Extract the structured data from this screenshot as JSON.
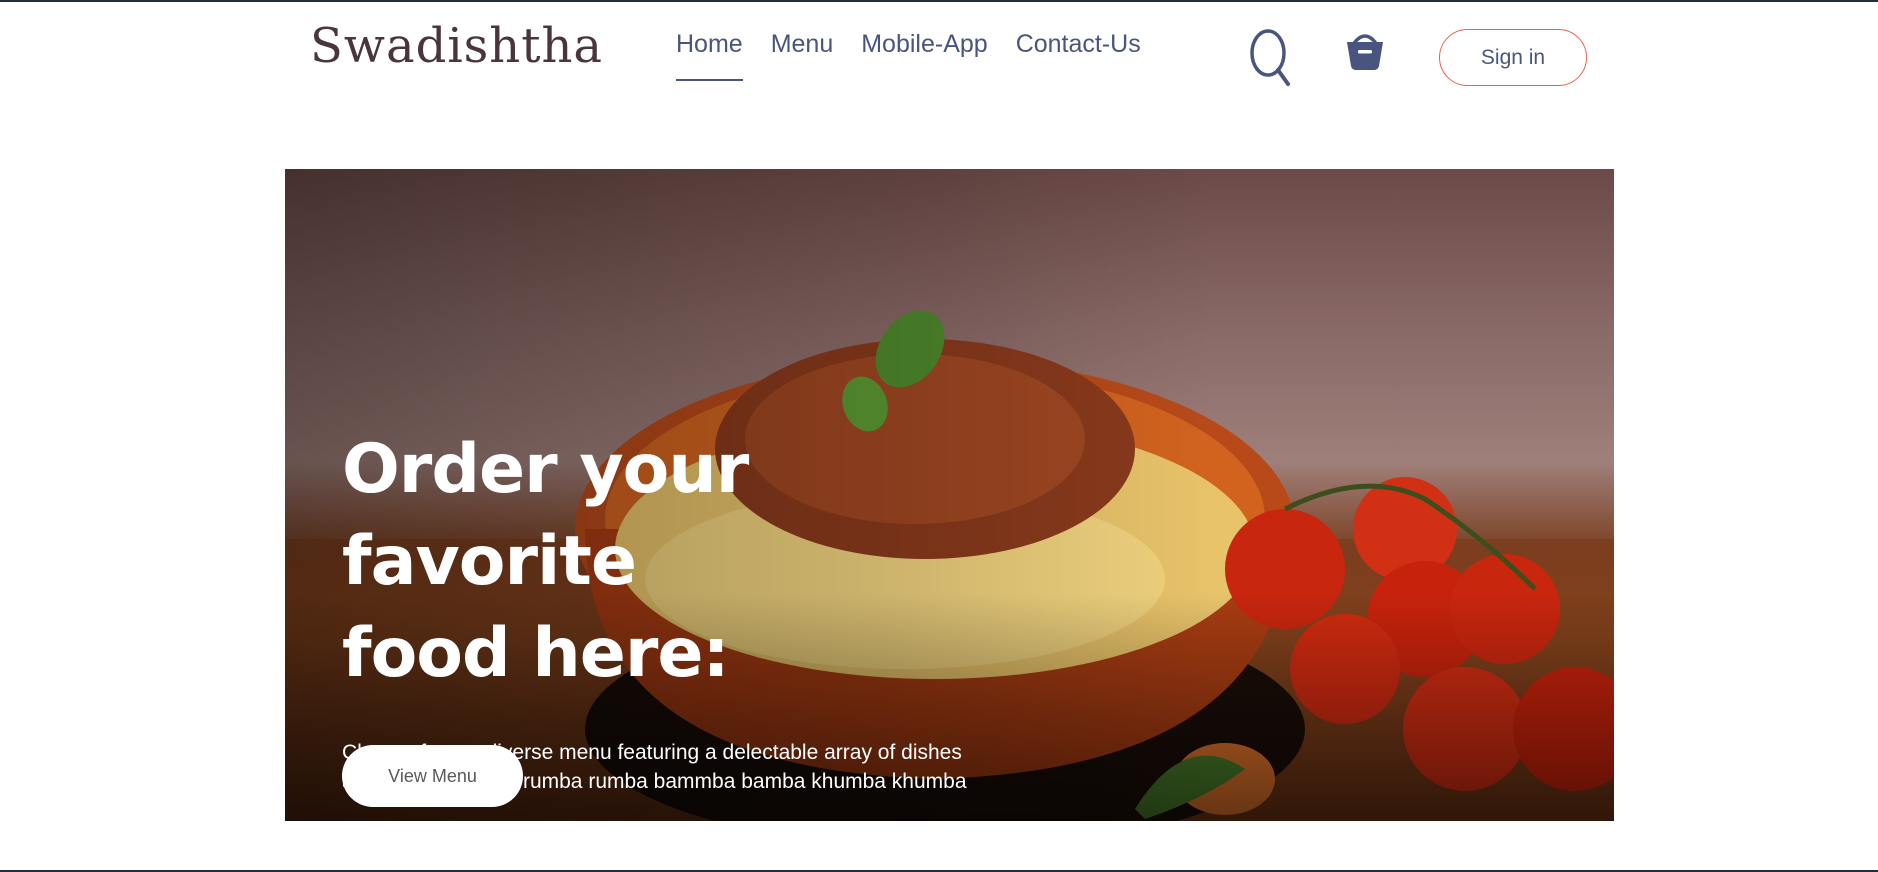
{
  "brand": {
    "name": "Swadishtha"
  },
  "nav": {
    "items": [
      {
        "label": "Home",
        "active": true
      },
      {
        "label": "Menu",
        "active": false
      },
      {
        "label": "Mobile-App",
        "active": false
      },
      {
        "label": "Contact-Us",
        "active": false
      }
    ]
  },
  "header": {
    "search_icon": "search-icon",
    "basket_icon": "basket-icon",
    "signin_label": "Sign in"
  },
  "hero": {
    "title_line1": "Order your favorite",
    "title_line2": "food here:",
    "description": "Choose from a diverse menu featuring a delectable array of dishes and bumba bumba rumba rumba bammba bamba khumba khumba",
    "cta_label": "View Menu"
  },
  "colors": {
    "nav_text": "#49557e",
    "logo_text": "#49353a",
    "accent_border": "#e8634e",
    "hero_text": "#ffffff"
  }
}
